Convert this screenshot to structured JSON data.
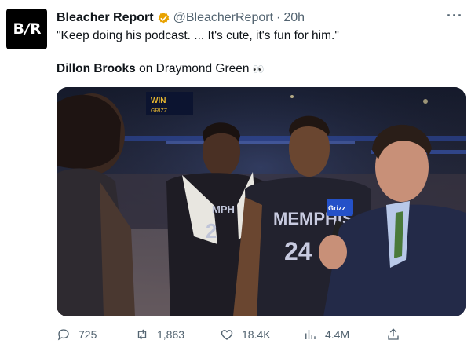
{
  "account": {
    "avatar_text_left": "B",
    "avatar_text_slash": "/",
    "avatar_text_right": "R",
    "name": "Bleacher Report",
    "handle": "@BleacherReport",
    "separator": "·",
    "time": "20h",
    "more_label": "···",
    "verified_color": "#e8a200"
  },
  "tweet": {
    "text": "\"Keep doing his podcast. ... It's cute, it's fun for him.\"",
    "subject_bold": "Dillon Brooks",
    "subject_rest": " on Draymond Green",
    "emoji": "👀"
  },
  "media": {
    "scoreboard_text": "WIN",
    "scoreboard_text_small": "GRIZZ",
    "jersey_center_team": "MEMPHIS",
    "jersey_center_number": "24",
    "jersey_left_team": "MPH",
    "jersey_left_number": "2",
    "mic_flag_text": "Grizz"
  },
  "actions": {
    "replies": "725",
    "retweets": "1,863",
    "likes": "18.4K",
    "views": "4.4M"
  }
}
